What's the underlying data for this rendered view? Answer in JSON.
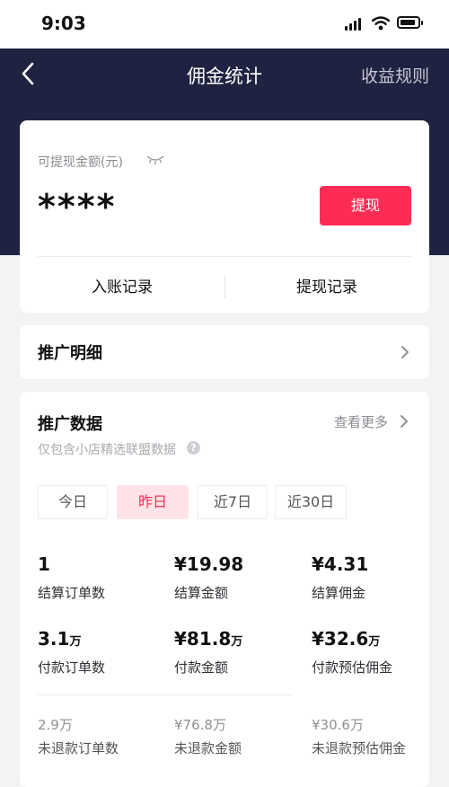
{
  "status_bar": {
    "time": "9:03"
  },
  "header": {
    "title": "佣金统计",
    "rules_link": "收益规则"
  },
  "balance": {
    "label": "可提现金额(元)",
    "value": "****",
    "withdraw_button": "提现",
    "income_records": "入账记录",
    "withdraw_records": "提现记录"
  },
  "promo_detail": {
    "title": "推广明细"
  },
  "promo_data": {
    "title": "推广数据",
    "see_more": "查看更多",
    "subtitle": "仅包含小店精选联盟数据",
    "help_icon": "?",
    "tabs": [
      {
        "label": "今日",
        "active": false
      },
      {
        "label": "昨日",
        "active": true
      },
      {
        "label": "近7日",
        "active": false
      },
      {
        "label": "近30日",
        "active": false
      }
    ],
    "metrics": [
      {
        "value": "1",
        "unit": "",
        "label": "结算订单数"
      },
      {
        "value": "¥19.98",
        "unit": "",
        "label": "结算金额"
      },
      {
        "value": "¥4.31",
        "unit": "",
        "label": "结算佣金"
      },
      {
        "value": "3.1",
        "unit": "万",
        "label": "付款订单数"
      },
      {
        "value": "¥81.8",
        "unit": "万",
        "label": "付款金额"
      },
      {
        "value": "¥32.6",
        "unit": "万",
        "label": "付款预估佣金"
      },
      {
        "value": "2.9",
        "unit": "万",
        "label": "未退款订单数"
      },
      {
        "value": "¥76.8",
        "unit": "万",
        "label": "未退款金额"
      },
      {
        "value": "¥30.6",
        "unit": "万",
        "label": "未退款预估佣金"
      }
    ]
  },
  "icons": {
    "back": "chevron-left-icon",
    "eye": "eye-closed-icon",
    "chevron": "chevron-right-icon",
    "help": "question-circle-icon"
  },
  "colors": {
    "header_bg": "#1f2240",
    "accent": "#fe2c55",
    "active_tab_bg": "#ffe3e8",
    "page_bg": "#f3f3f5"
  }
}
